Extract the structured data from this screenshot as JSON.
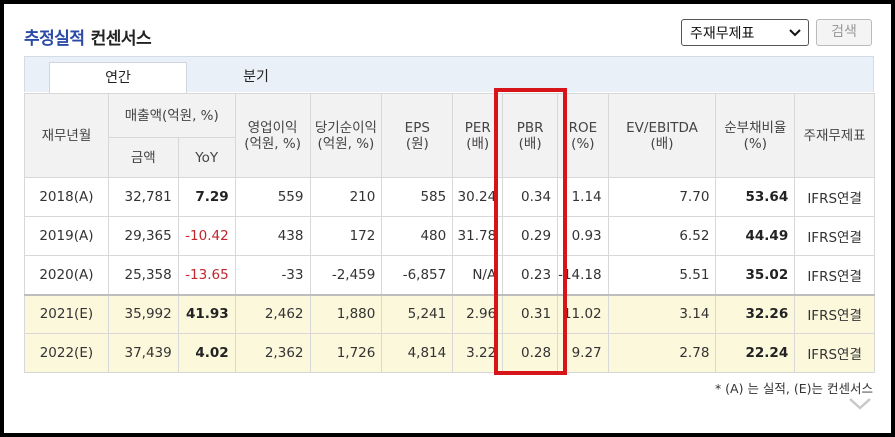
{
  "header": {
    "title_main": "추정실적",
    "title_sub": "컨센서스"
  },
  "controls": {
    "select_value": "주재무제표",
    "search_label": "검색"
  },
  "tabs": [
    {
      "label": "연간",
      "active": true
    },
    {
      "label": "분기",
      "active": false
    }
  ],
  "table": {
    "col_year": "재무년월",
    "col_sales_group": "매출액(억원, %)",
    "col_sales_amount": "금액",
    "col_sales_yoy": "YoY",
    "col_op_profit": [
      "영업이익",
      "(억원, %)"
    ],
    "col_net_profit": [
      "당기순이익",
      "(억원, %)"
    ],
    "col_eps": [
      "EPS",
      "(원)"
    ],
    "col_per": [
      "PER",
      "(배)"
    ],
    "col_pbr": [
      "PBR",
      "(배)"
    ],
    "col_roe": [
      "ROE",
      "(%)"
    ],
    "col_ev": [
      "EV/EBITDA",
      "(배)"
    ],
    "col_debt": [
      "순부채비율",
      "(%)"
    ],
    "col_std": "주재무제표",
    "rows": [
      {
        "year": "2018(A)",
        "sales": "32,781",
        "yoy": "7.29",
        "op": "559",
        "net": "210",
        "eps": "585",
        "per": "30.24",
        "pbr": "0.34",
        "roe": "1.14",
        "ev": "7.70",
        "debt": "53.64",
        "std": "IFRS연결"
      },
      {
        "year": "2019(A)",
        "sales": "29,365",
        "yoy": "-10.42",
        "op": "438",
        "net": "172",
        "eps": "480",
        "per": "31.78",
        "pbr": "0.29",
        "roe": "0.93",
        "ev": "6.52",
        "debt": "44.49",
        "std": "IFRS연결"
      },
      {
        "year": "2020(A)",
        "sales": "25,358",
        "yoy": "-13.65",
        "op": "-33",
        "net": "-2,459",
        "eps": "-6,857",
        "per": "N/A",
        "pbr": "0.23",
        "roe": "-14.18",
        "ev": "5.51",
        "debt": "35.02",
        "std": "IFRS연결"
      },
      {
        "year": "2021(E)",
        "sales": "35,992",
        "yoy": "41.93",
        "op": "2,462",
        "net": "1,880",
        "eps": "5,241",
        "per": "2.96",
        "pbr": "0.31",
        "roe": "11.02",
        "ev": "3.14",
        "debt": "32.26",
        "std": "IFRS연결"
      },
      {
        "year": "2022(E)",
        "sales": "37,439",
        "yoy": "4.02",
        "op": "2,362",
        "net": "1,726",
        "eps": "4,814",
        "per": "3.22",
        "pbr": "0.28",
        "roe": "9.27",
        "ev": "2.78",
        "debt": "22.24",
        "std": "IFRS연결"
      }
    ]
  },
  "footnote": "* (A) 는 실적, (E)는 컨센서스",
  "colors": {
    "accent": "#2b4aa8",
    "highlight": "#d7141a",
    "negative": "#c0262d",
    "estimate_bg": "#fbf8dc"
  },
  "icons": {
    "select": "chevron-down-icon",
    "more": "chevron-down-icon"
  }
}
